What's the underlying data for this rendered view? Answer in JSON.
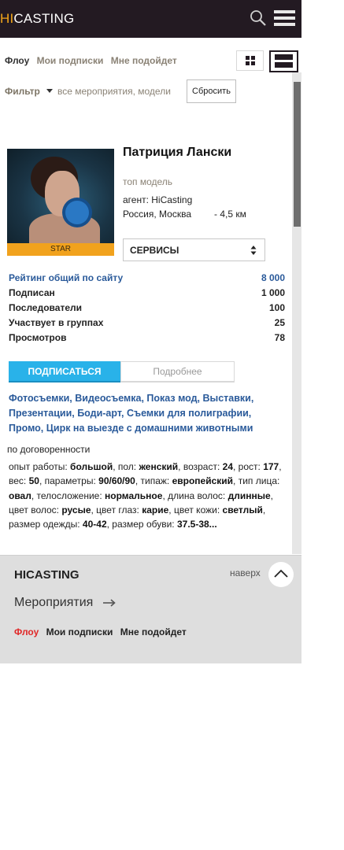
{
  "header": {
    "logo_hi": "HI",
    "logo_rest": "CASTING",
    "icons": [
      "search-icon",
      "menu-icon"
    ],
    "colors": {
      "background": "#231a22",
      "accent": "#f2a51a"
    }
  },
  "subnav": {
    "tabs": [
      {
        "label": "Флоу",
        "active": true
      },
      {
        "label": "Мои подписки",
        "active": false
      },
      {
        "label": "Мне подойдет",
        "active": false
      }
    ],
    "view_modes": [
      "grid-view-icon",
      "list-view-icon"
    ]
  },
  "filter": {
    "label": "Фильтр",
    "value": "все мероприятия, модели",
    "reset_label": "Сбросить"
  },
  "profile": {
    "name": "Патриция Лански",
    "role": "топ модель",
    "agent": "агент: HiCasting",
    "location": "Россия, Москва",
    "distance": "- 4,5 км",
    "badge": "STAR",
    "services_select": "СЕРВИСЫ"
  },
  "stats": [
    {
      "label": "Рейтинг общий по сайту",
      "value": "8 000",
      "highlight": true
    },
    {
      "label": "Подписан",
      "value": "1 000",
      "highlight": false
    },
    {
      "label": "Последователи",
      "value": "100",
      "highlight": false
    },
    {
      "label": "Участвует в группах",
      "value": "25",
      "highlight": false
    },
    {
      "label": "Просмотров",
      "value": "78",
      "highlight": false
    }
  ],
  "actions": {
    "subscribe": "ПОДПИСАТЬСЯ",
    "details": "Подробнее"
  },
  "services_text": "Фотосъемки, Видеосъемка, Показ мод, Выставки, Презентации, Боди-арт, Съемки для полиграфии, Промо, Цирк на выезде с домашними животными",
  "price": "по договоренности",
  "details": [
    {
      "k": "опыт работы: ",
      "v": "большой"
    },
    {
      "k": ", пол: ",
      "v": "женский"
    },
    {
      "k": ", возраст: ",
      "v": "24"
    },
    {
      "k": ", рост: ",
      "v": "177"
    },
    {
      "k": ", вес: ",
      "v": "50"
    },
    {
      "k": ", параметры: ",
      "v": "90/60/90"
    },
    {
      "k": ", типаж: ",
      "v": "европейский"
    },
    {
      "k": ", тип лица: ",
      "v": "овал"
    },
    {
      "k": ", телосложение: ",
      "v": "нормальное"
    },
    {
      "k": ", длина волос: ",
      "v": "длинные"
    },
    {
      "k": ", цвет волос: ",
      "v": "русые"
    },
    {
      "k": ", цвет глаз: ",
      "v": "карие"
    },
    {
      "k": ", цвет кожи: ",
      "v": "светлый"
    },
    {
      "k": ", размер одежды: ",
      "v": "40-42"
    },
    {
      "k": ", размер обуви: ",
      "v": "37.5-38..."
    }
  ],
  "footer": {
    "brand": "HICASTING",
    "up_label": "наверх",
    "events_link": "Мероприятия",
    "nav": [
      {
        "label": "Флоу",
        "active": true
      },
      {
        "label": "Мои подписки",
        "active": false
      },
      {
        "label": "Мне подойдет",
        "active": false
      }
    ]
  }
}
